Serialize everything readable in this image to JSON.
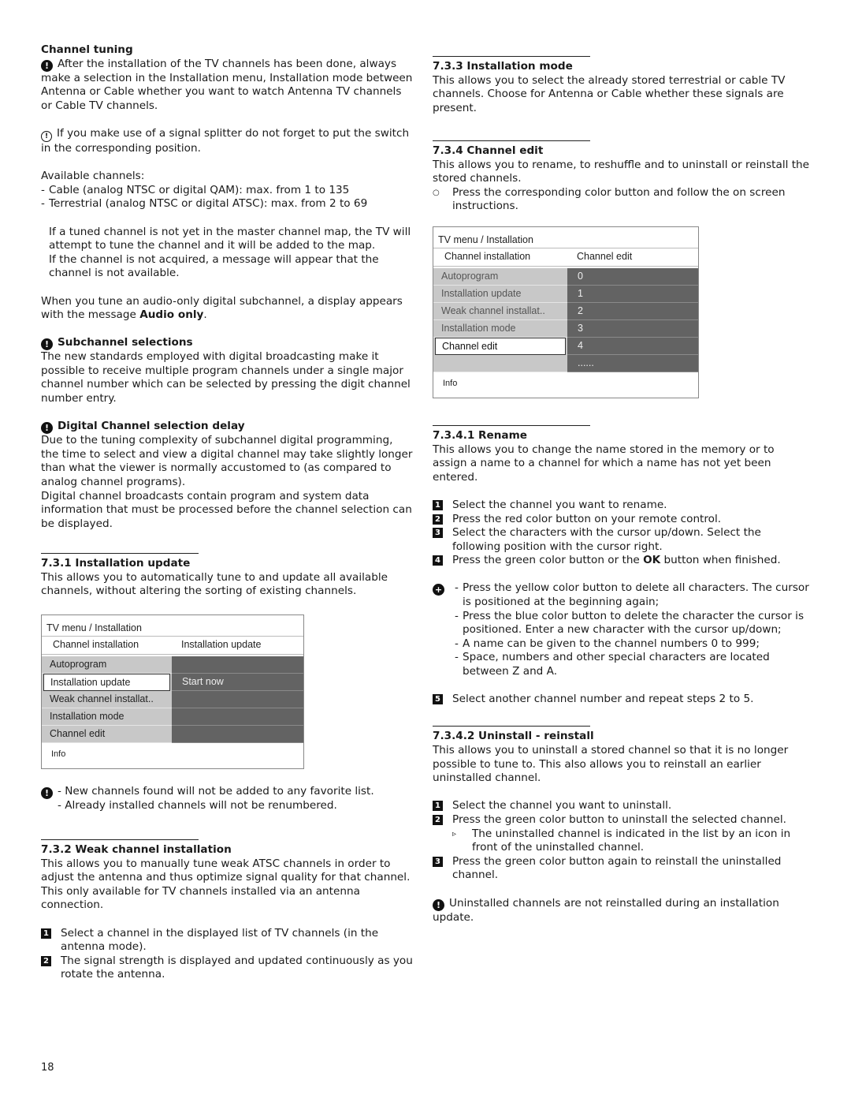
{
  "left": {
    "channel_tuning": {
      "heading": "Channel tuning",
      "note1": "After the installation of the TV channels has been done, always make a selection in the Installation menu, Installation mode between Antenna or Cable whether you want to watch Antenna TV channels or Cable TV channels.",
      "warning": "If you make use of a signal splitter do not forget to put the switch in the corresponding position.",
      "available_label": "Available channels:",
      "available_items": [
        "Cable (analog NTSC or digital QAM): max. from 1 to 135",
        "Terrestrial (analog NTSC or digital ATSC): max. from 2 to 69"
      ],
      "tuned_para_1": "If a tuned channel is not yet in the master channel map, the TV will attempt to tune the channel and it will be added to the map.",
      "tuned_para_2": "If the channel is not acquired, a message will appear that the channel is not available.",
      "audio_para_pre": "When you tune an audio-only digital subchannel, a display appears with the message ",
      "audio_para_bold": "Audio only",
      "audio_para_post": "."
    },
    "subchannel": {
      "heading": "Subchannel selections",
      "text": "The new standards employed with digital broadcasting make it possible to receive multiple program channels under a single major channel number which can be selected by pressing the digit channel number entry."
    },
    "delay": {
      "heading": "Digital Channel selection delay",
      "text1": "Due to the tuning complexity of subchannel digital programming, the time to select and view a digital channel may take slightly longer than what the viewer is normally accustomed to (as compared to analog channel programs).",
      "text2": "Digital channel broadcasts contain program and system data information that must be processed before the channel selection can be displayed."
    },
    "installation_update": {
      "heading": "7.3.1 Installation update",
      "text": "This allows you to automatically tune to and update all available channels, without altering the sorting of existing channels.",
      "menu": {
        "title": "TV menu / Installation",
        "header_left": "Channel installation",
        "header_right": "Installation update",
        "left_items": [
          "Autoprogram",
          "Installation update",
          "Weak channel installat..",
          "Installation mode",
          "Channel edit"
        ],
        "right_items": [
          "",
          "Start now",
          "",
          "",
          ""
        ],
        "info": "Info"
      },
      "notes": [
        "- New channels found will not be added to any favorite list.",
        "- Already installed channels will not be renumbered."
      ]
    },
    "weak_channel": {
      "heading": "7.3.2 Weak channel installation",
      "text": "This allows you to manually tune weak ATSC channels in order to adjust the antenna and thus optimize signal quality for that channel. This only available for TV channels installed via an antenna connection.",
      "steps": [
        {
          "n": "1",
          "text": "Select a channel in the displayed list of TV channels (in the antenna mode)."
        },
        {
          "n": "2",
          "text": "The signal strength is displayed and updated continuously as you rotate the antenna."
        }
      ]
    },
    "page_number": "18"
  },
  "right": {
    "installation_mode": {
      "heading": "7.3.3 Installation mode",
      "text": "This allows you to select the already stored terrestrial or cable TV channels. Choose for Antenna or Cable whether these signals are present."
    },
    "channel_edit": {
      "heading": "7.3.4 Channel edit",
      "text": "This allows you to rename, to reshuffle and to uninstall or reinstall the stored channels.",
      "bullet": "Press the corresponding color button and follow the on screen instructions.",
      "menu": {
        "title": "TV menu / Installation",
        "header_left": "Channel installation",
        "header_right": "Channel edit",
        "left_items": [
          "Autoprogram",
          "Installation update",
          "Weak channel installat..",
          "Installation mode",
          "Channel edit",
          ""
        ],
        "right_items": [
          "0",
          "1",
          "2",
          "3",
          "4",
          "......"
        ],
        "info": "Info"
      }
    },
    "rename": {
      "heading": "7.3.4.1  Rename",
      "text": "This allows you to change the name stored in the memory or to assign a name to a channel for which a name has not yet been entered.",
      "steps": [
        {
          "n": "1",
          "text": "Select the channel you want to rename."
        },
        {
          "n": "2",
          "text": "Press the red color button on your remote control."
        },
        {
          "n": "3",
          "text": "Select the characters with the cursor up/down. Select the following position with the cursor right."
        }
      ],
      "step4": {
        "n": "4",
        "pre": "Press the green color button or the ",
        "bold": "OK",
        "post": " button when finished."
      },
      "tips": [
        "Press the yellow color button to delete all characters. The cursor is positioned at the beginning again;",
        "Press the blue color button to delete the character the cursor is positioned. Enter a new character with the cursor up/down;",
        "A name can be given to the channel numbers 0 to 999;",
        "Space, numbers and other special characters are located between Z and A."
      ],
      "step5": {
        "n": "5",
        "text": "Select another channel number and repeat steps 2 to 5."
      }
    },
    "uninstall": {
      "heading": "7.3.4.2  Uninstall - reinstall",
      "text": "This allows you to uninstall a stored channel so that it is no longer possible to tune to. This also allows you to reinstall an earlier uninstalled channel.",
      "steps": [
        {
          "n": "1",
          "text": "Select the channel you want to uninstall."
        },
        {
          "n": "2",
          "text": "Press the green color button to uninstall the selected channel."
        }
      ],
      "sub_bullet": "The uninstalled channel is indicated in the list by an icon in front of the uninstalled channel.",
      "step3": {
        "n": "3",
        "text": "Press the green color button again to reinstall the uninstalled channel."
      },
      "note": "Uninstalled channels are not reinstalled during an installation update."
    }
  }
}
